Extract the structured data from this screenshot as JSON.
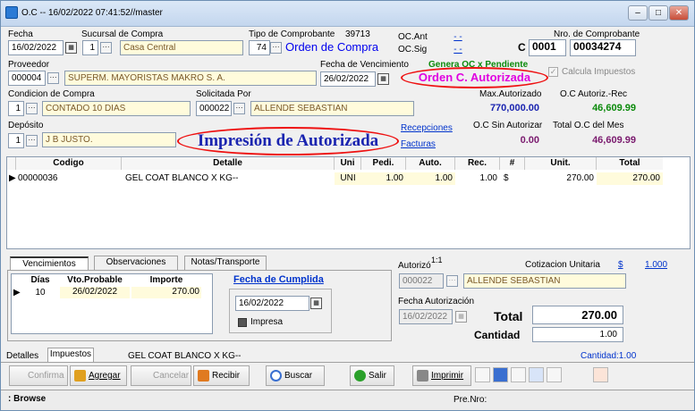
{
  "window": {
    "title": "O.C -- 16/02/2022 07:41:52//master"
  },
  "header": {
    "fecha_label": "Fecha",
    "fecha_value": "16/02/2022",
    "sucursal_label": "Sucursal de Compra",
    "sucursal_code": "1",
    "sucursal_name": "Casa Central",
    "tipo_label": "Tipo de Comprobante",
    "tipo_number": "39713",
    "tipo_code": "74",
    "tipo_name": "Orden de Compra",
    "oc_ant_label": "OC.Ant",
    "oc_ant_value": "- -",
    "oc_sig_label": "OC.Sig",
    "oc_sig_value": "- -",
    "nro_label": "Nro. de Comprobante",
    "nro_letter": "C",
    "nro_pv": "0001",
    "nro_num": "00034274",
    "proveedor_label": "Proveedor",
    "proveedor_code": "000004",
    "proveedor_name": "SUPERM. MAYORISTAS MAKRO S. A.",
    "vencimiento_label": "Fecha de Vencimiento",
    "vencimiento_value": "26/02/2022",
    "genera_oc": "Genera OC x Pendiente",
    "orden_autorizada": "Orden C. Autorizada",
    "calcula_impuestos": "Calcula Impuestos",
    "condicion_label": "Condicion de Compra",
    "condicion_code": "1",
    "condicion_name": "CONTADO 10 DIAS",
    "solicitada_label": "Solicitada Por",
    "solicitada_code": "000022",
    "solicitada_name": "ALLENDE SEBASTIAN",
    "max_autorizado_label": "Max.Autorizado",
    "max_autorizado_value": "770,000.00",
    "oc_autoriz_label": "O.C Autoriz.-Rec",
    "oc_autoriz_value": "46,609.99",
    "deposito_label": "Depósito",
    "deposito_code": "1",
    "deposito_name": "J B JUSTO.",
    "impresion": "Impresión de Autorizada",
    "recepciones": "Recepciones",
    "facturas": "Facturas",
    "oc_sin_label": "O.C Sin Autorizar",
    "oc_sin_value": "0.00",
    "total_mes_label": "Total O.C del Mes",
    "total_mes_value": "46,609.99"
  },
  "grid": {
    "columns": [
      "Codigo",
      "Detalle",
      "Uni",
      "Pedi.",
      "Auto.",
      "Rec.",
      "#",
      "Unit.",
      "Total"
    ],
    "rows": [
      {
        "codigo": "00000036",
        "detalle": "GEL COAT BLANCO X KG--",
        "uni": "UNI",
        "pedi": "1.00",
        "auto": "1.00",
        "rec": "1.00",
        "moneda": "$",
        "unit": "270.00",
        "total": "270.00"
      }
    ]
  },
  "tabs": {
    "vencimientos": "Vencimientos",
    "observaciones": "Observaciones",
    "notas": "Notas/Transporte"
  },
  "venc": {
    "columns": [
      "Días",
      "Vto.Probable",
      "Importe"
    ],
    "row": {
      "dias": "10",
      "vto": "26/02/2022",
      "importe": "270.00"
    }
  },
  "cumplida": {
    "label": "Fecha de Cumplida",
    "value": "16/02/2022",
    "impresa": "Impresa"
  },
  "autorizo": {
    "label": "Autorizó",
    "ratio": "1:1",
    "code": "000022",
    "name": "ALLENDE SEBASTIAN",
    "fecha_label": "Fecha Autorización",
    "fecha_value": "16/02/2022"
  },
  "cotizacion": {
    "label": "Cotizacion Unitaria",
    "symbol": "$",
    "value": "1.000"
  },
  "totales": {
    "total_label": "Total",
    "total_value": "270.00",
    "cantidad_label": "Cantidad",
    "cantidad_value": "1.00"
  },
  "bottom_tabs": {
    "detalles": "Detalles",
    "impuestos": "Impuestos",
    "item": "GEL COAT BLANCO X KG--",
    "cantidad": "Cantidad:1.00"
  },
  "toolbar": {
    "confirma": "Confirma",
    "agregar": "Agregar",
    "cancelar": "Cancelar",
    "recibir": "Recibir",
    "buscar": "Buscar",
    "salir": "Salir",
    "imprimir": "Imprimir"
  },
  "status": {
    "mode": ": Browse",
    "pre_nro": "Pre.Nro:"
  }
}
